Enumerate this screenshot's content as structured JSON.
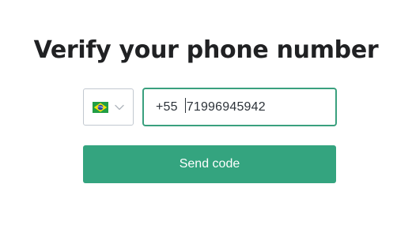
{
  "page": {
    "title": "Verify your phone number"
  },
  "country_select": {
    "flag_icon": "brazil-flag-icon",
    "chevron_icon": "chevron-down-icon",
    "colors": {
      "border": "#c2c8d0",
      "flag_green": "#229e45",
      "flag_yellow": "#f8e509",
      "flag_blue": "#2b49a3",
      "chevron": "#b0b6bd"
    }
  },
  "phone_input": {
    "country_code": "+55",
    "value": "71996945942",
    "border_color": "#3aa07e"
  },
  "send_button": {
    "label": "Send code",
    "color": "#34a47f"
  }
}
